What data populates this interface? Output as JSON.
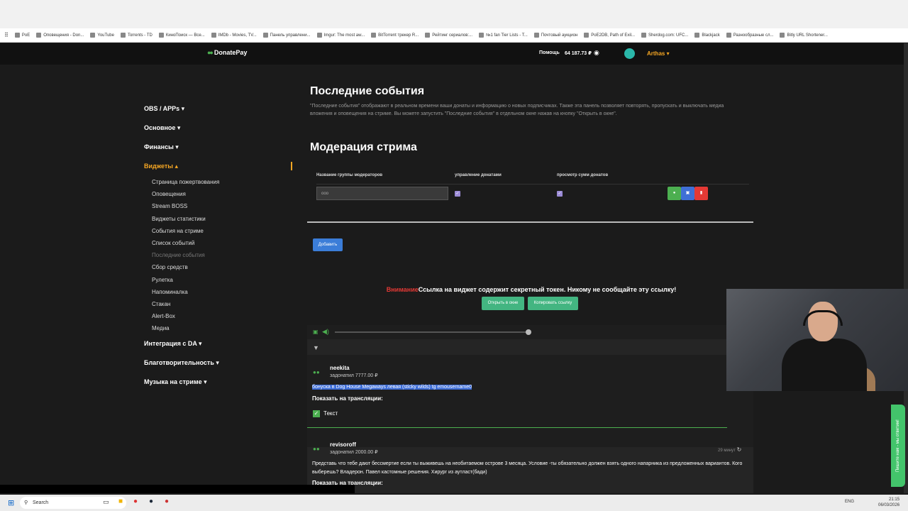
{
  "bookmarks": [
    "PoE",
    "Оповещения - Don...",
    "YouTube",
    "Torrents - TD",
    "КиноПоиск — Все...",
    "IMDb - Movies, TV...",
    "Панель управлени...",
    "Imgur: The most aw...",
    "BitTorrent трекер R...",
    "Рейтинг сериалов:...",
    "№1 fan Tier Lists - T...",
    "Почтовый аукцион",
    "PoE2DB, Path of Exil...",
    "Sherdog.com: UFC...",
    "Blackjack",
    "Разнообразные сл...",
    "Bitly URL Shortener..."
  ],
  "header": {
    "logo": "DonatePay",
    "help": "Помощь",
    "balance": "64 187.73 ₽",
    "user": "Arthas"
  },
  "sidebar": {
    "groups_top": [
      {
        "label": "OBS / APPs ▾"
      },
      {
        "label": "Основное ▾"
      },
      {
        "label": "Финансы ▾"
      },
      {
        "label": "Виджеты ▴"
      }
    ],
    "widgets": [
      "Страница пожертвования",
      "Оповещения",
      "Stream BOSS",
      "Виджеты статистики",
      "События на стриме",
      "Список событий",
      "Последние события",
      "Сбор средств",
      "Рулетка",
      "Напоминалка",
      "Стакан",
      "Alert-Box",
      "Медиа"
    ],
    "groups_bottom": [
      {
        "label": "Интеграция с DA ▾"
      },
      {
        "label": "Благотворительность ▾"
      },
      {
        "label": "Музыка на стриме ▾"
      }
    ]
  },
  "main": {
    "title": "Последние события",
    "description": "\"Последние события\" отображают в реальном времени ваши донаты и информацию о новых подписчиках. Также эта панель позволяет повторять, пропускать и выключать медиа вложения и оповещения на стриме. Вы можете запустить \"Последние события\" в отдельном окне нажав на кнопку \"Открыть в окне\".",
    "moderation_title": "Модерация стрима",
    "col_group": "Название группы модераторов",
    "col_manage": "управление донатами",
    "col_view": "просмотр сумм донатов",
    "group_value": "ooo",
    "add_button": "Добавить",
    "warning_prefix": "Внимание",
    "warning_text": "Ссылка на виджет содержит секретный токен. Никому не сообщайте эту ссылку!",
    "open_window": "Открыть в окне",
    "copy_link": "Копировать ссылку"
  },
  "events": [
    {
      "name": "neekita",
      "sub": "задонатил 7777.00 ₽",
      "message": "бонуска в Dog House Megaways левая (sticky wilds) tg emousername0",
      "show_label": "Показать на трансляции:",
      "option": "Текст"
    },
    {
      "name": "revisoroff",
      "sub": "задонатил 2000.00 ₽",
      "time": "29 минут",
      "message": "Представь что тебе дают бессмертие если ты выживешь на необитаемом острове 3 месяца. Условие -ты обязательно должен взять одного напарника из предложенных вариантов. Кого выберешь? Владерон. Павел кастомные решения. Хирург из аутласт(бади)",
      "show_label": "Показать на трансляции:"
    }
  ],
  "side_tab": "Пишите нам - мы ответим!",
  "taskbar": {
    "search": "Search",
    "lang": "ENG",
    "time": "21:15",
    "date": "06/03/2026"
  }
}
